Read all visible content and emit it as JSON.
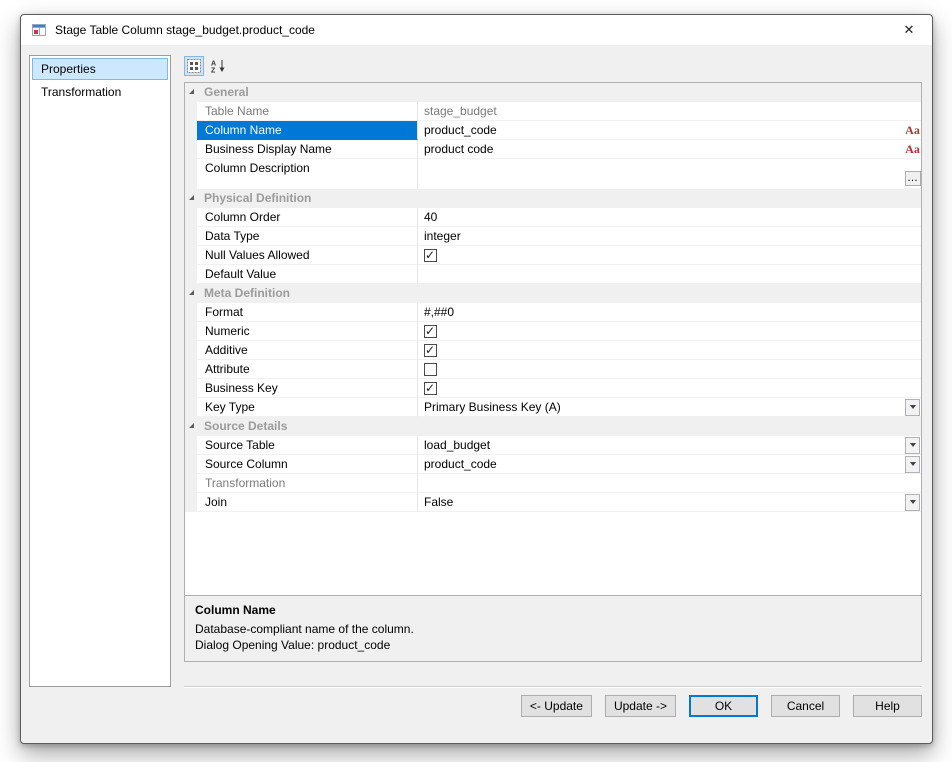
{
  "window": {
    "title": "Stage Table Column stage_budget.product_code",
    "close_glyph": "✕"
  },
  "sidebar": {
    "items": [
      {
        "label": "Properties",
        "selected": true
      },
      {
        "label": "Transformation",
        "selected": false
      }
    ]
  },
  "toolbar": {
    "buttons": [
      {
        "name": "categorized-view",
        "active": true
      },
      {
        "name": "sort-alphabetical",
        "active": false
      }
    ]
  },
  "icons": {
    "font_glyph": "Aa",
    "ellipsis_glyph": "…"
  },
  "grid": {
    "sections": [
      {
        "title": "General",
        "rows": [
          {
            "label": "Table Name",
            "value": "stage_budget",
            "type": "readonly"
          },
          {
            "label": "Column Name",
            "value": "product_code",
            "type": "text",
            "selected": true,
            "right": "font"
          },
          {
            "label": "Business Display Name",
            "value": "product code",
            "type": "text",
            "right": "font"
          },
          {
            "label": "Column Description",
            "value": "",
            "type": "multiline",
            "right": "ellipsis"
          }
        ]
      },
      {
        "title": "Physical Definition",
        "rows": [
          {
            "label": "Column Order",
            "value": "40",
            "type": "text"
          },
          {
            "label": "Data Type",
            "value": "integer",
            "type": "text"
          },
          {
            "label": "Null Values Allowed",
            "checked": true,
            "type": "checkbox"
          },
          {
            "label": "Default Value",
            "value": "",
            "type": "text"
          }
        ]
      },
      {
        "title": "Meta Definition",
        "rows": [
          {
            "label": "Format",
            "value": "#,##0",
            "type": "text"
          },
          {
            "label": "Numeric",
            "checked": true,
            "type": "checkbox"
          },
          {
            "label": "Additive",
            "checked": true,
            "type": "checkbox"
          },
          {
            "label": "Attribute",
            "checked": false,
            "type": "checkbox"
          },
          {
            "label": "Business Key",
            "checked": true,
            "type": "checkbox"
          },
          {
            "label": "Key Type",
            "value": "Primary Business Key (A)",
            "type": "dropdown"
          }
        ]
      },
      {
        "title": "Source Details",
        "rows": [
          {
            "label": "Source Table",
            "value": "load_budget",
            "type": "dropdown"
          },
          {
            "label": "Source Column",
            "value": "product_code",
            "type": "dropdown"
          },
          {
            "label": "Transformation",
            "value": "",
            "type": "disabled"
          },
          {
            "label": "Join",
            "value": "False",
            "type": "dropdown"
          }
        ]
      }
    ]
  },
  "description": {
    "title": "Column Name",
    "line1": "Database-compliant name of the column.",
    "line2": "Dialog Opening Value: product_code"
  },
  "buttons": [
    {
      "label": "<- Update"
    },
    {
      "label": "Update ->"
    },
    {
      "label": "OK",
      "default": true
    },
    {
      "label": "Cancel"
    },
    {
      "label": "Help"
    }
  ],
  "colors": {
    "selection": "#0078d7",
    "accent": "#0078d7",
    "sidebar_selected_bg": "#cce8ff",
    "section_text": "#9b9b9b",
    "font_icon": "#b03030"
  }
}
